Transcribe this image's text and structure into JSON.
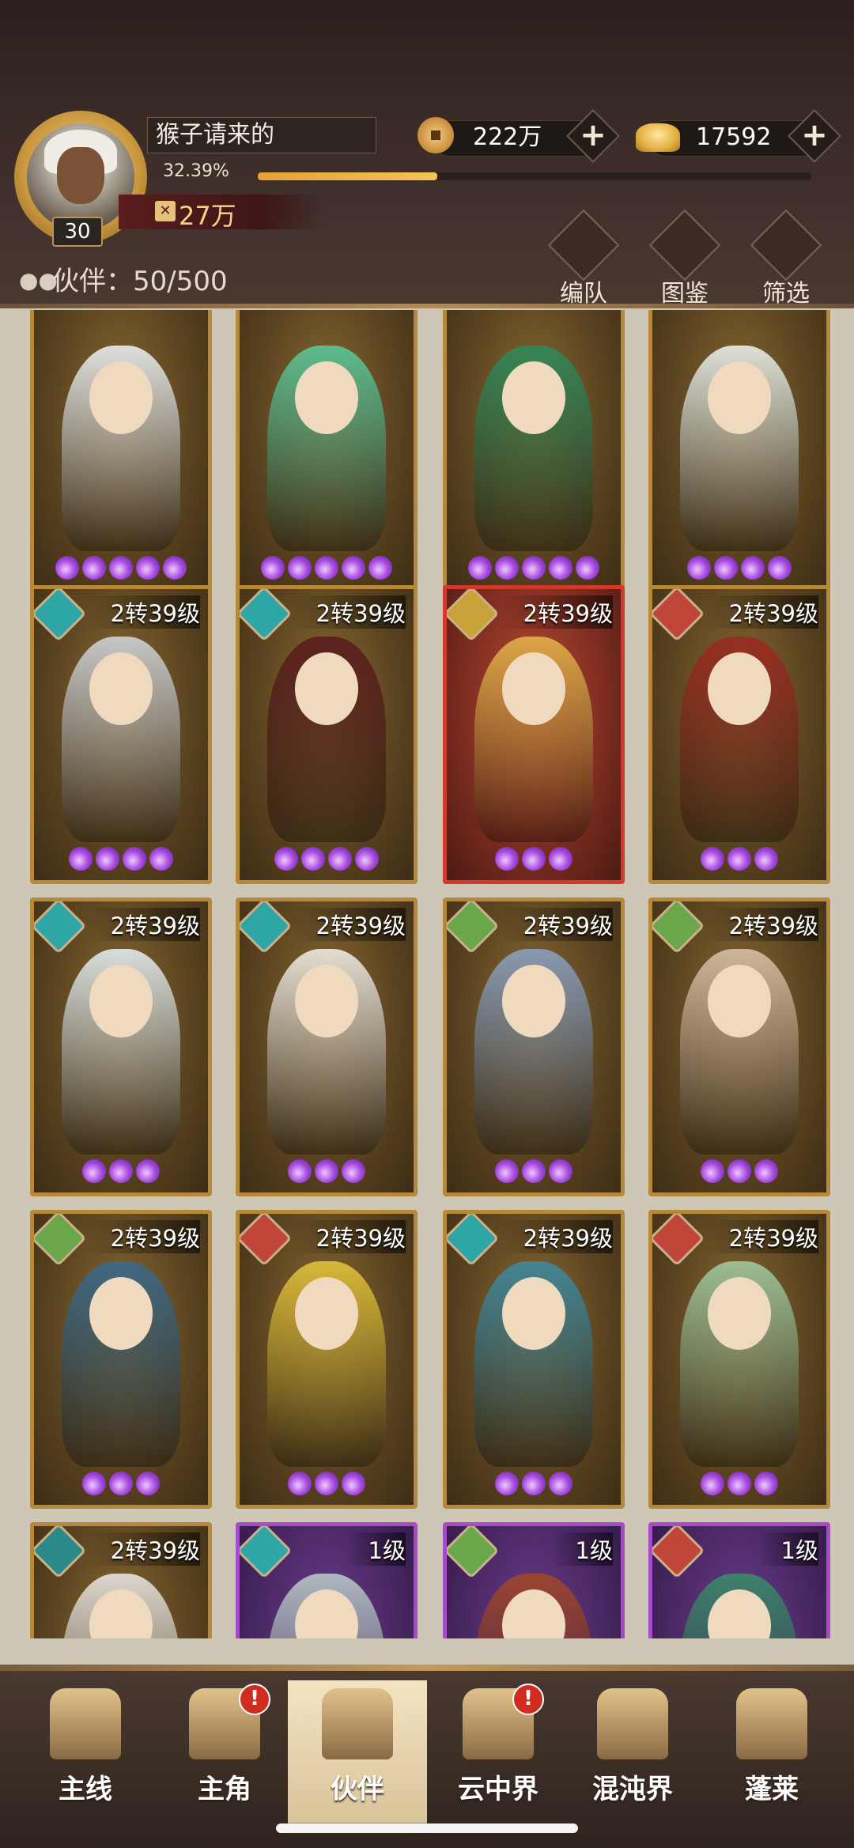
{
  "player": {
    "name": "猴子请来的",
    "level": "30",
    "exp_percent_text": "32.39%",
    "exp_fraction": 0.3239,
    "power": "27万"
  },
  "currency": [
    {
      "name": "coin",
      "value": "222万"
    },
    {
      "name": "ingot",
      "value": "17592"
    }
  ],
  "partner_count": "伙伴：50/500",
  "toolbar": [
    "编队",
    "图鉴",
    "筛选"
  ],
  "rows": [
    [
      {
        "level": "",
        "stars": 5,
        "element_color": "#2ea6a6",
        "body_color": "#e9eef2"
      },
      {
        "level": "",
        "stars": 5,
        "element_color": "#4ab07a",
        "body_color": "#5bc79a"
      },
      {
        "level": "",
        "stars": 5,
        "element_color": "#3a8a55",
        "body_color": "#2f8a5a"
      },
      {
        "level": "",
        "stars": 4,
        "element_color": "#2ea6a6",
        "body_color": "#e7efe9"
      }
    ],
    [
      {
        "level": "2转39级",
        "stars": 4,
        "element_color": "#2ea6a6",
        "body_color": "#cfd3d8"
      },
      {
        "level": "2转39级",
        "stars": 4,
        "element_color": "#2ea6a6",
        "body_color": "#5a1c1c"
      },
      {
        "level": "2转39级",
        "stars": 3,
        "element_color": "#c9a23a",
        "body_color": "#e3b24a",
        "frame": "red"
      },
      {
        "level": "2转39级",
        "stars": 3,
        "element_color": "#c0463a",
        "body_color": "#9a2a20"
      }
    ],
    [
      {
        "level": "2转39级",
        "stars": 3,
        "element_color": "#2ea6a6",
        "body_color": "#e3ecef"
      },
      {
        "level": "2转39级",
        "stars": 3,
        "element_color": "#2ea6a6",
        "body_color": "#efece4"
      },
      {
        "level": "2转39级",
        "stars": 3,
        "element_color": "#6aa64a",
        "body_color": "#8aa0c0"
      },
      {
        "level": "2转39级",
        "stars": 3,
        "element_color": "#6aa64a",
        "body_color": "#d8c0a8"
      }
    ],
    [
      {
        "level": "2转39级",
        "stars": 3,
        "element_color": "#6aa64a",
        "body_color": "#3a6a8a"
      },
      {
        "level": "2转39级",
        "stars": 3,
        "element_color": "#c0463a",
        "body_color": "#e3c23a"
      },
      {
        "level": "2转39级",
        "stars": 3,
        "element_color": "#2ea6a6",
        "body_color": "#3e8aa0"
      },
      {
        "level": "2转39级",
        "stars": 3,
        "element_color": "#c0463a",
        "body_color": "#a0c8a0"
      }
    ],
    [
      {
        "level": "2转39级",
        "stars": 0,
        "element_color": "#2a8a8a",
        "body_color": "#e8e4e0"
      },
      {
        "level": "1级",
        "stars": 0,
        "element_color": "#2ea6a6",
        "body_color": "#b8c8c8",
        "frame": "purple"
      },
      {
        "level": "1级",
        "stars": 0,
        "element_color": "#6aa64a",
        "body_color": "#a0462a",
        "frame": "purple"
      },
      {
        "level": "1级",
        "stars": 0,
        "element_color": "#c0463a",
        "body_color": "#3a8a6a",
        "frame": "purple"
      }
    ]
  ],
  "nav": [
    {
      "label": "主线",
      "badge": false,
      "active": false
    },
    {
      "label": "主角",
      "badge": true,
      "active": false
    },
    {
      "label": "伙伴",
      "badge": false,
      "active": true
    },
    {
      "label": "云中界",
      "badge": true,
      "active": false
    },
    {
      "label": "混沌界",
      "badge": false,
      "active": false
    },
    {
      "label": "蓬莱",
      "badge": false,
      "active": false
    }
  ],
  "badge_text": "!"
}
